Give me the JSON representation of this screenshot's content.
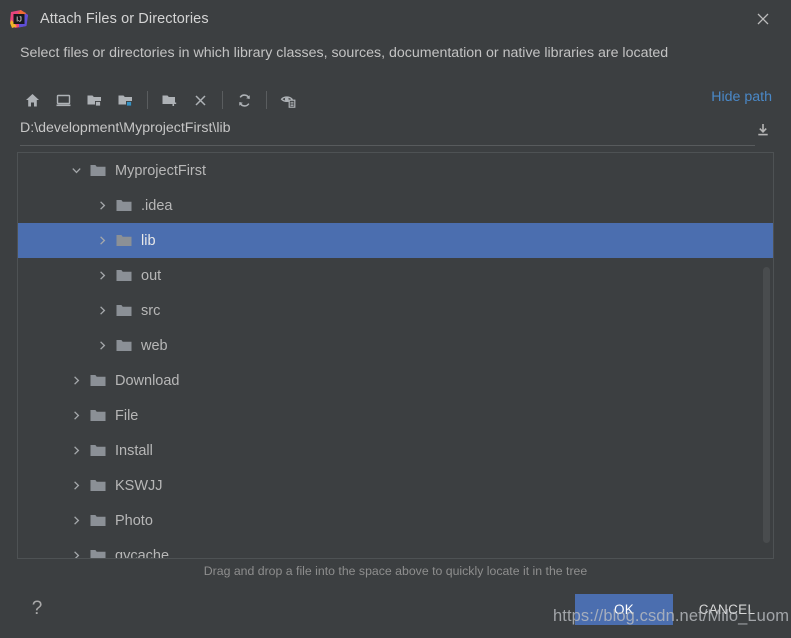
{
  "titlebar": {
    "title": "Attach Files or Directories",
    "logo_icon": "intellij-idea-logo-icon",
    "close_icon": "close-icon"
  },
  "subtitle": "Select files or directories in which library classes, sources, documentation or native libraries are located",
  "toolbar": {
    "hide_path_label": "Hide path",
    "buttons": [
      {
        "name": "home-button",
        "icon": "home-icon"
      },
      {
        "name": "desktop-button",
        "icon": "desktop-icon"
      },
      {
        "name": "module-directory-button",
        "icon": "folder-module-icon"
      },
      {
        "name": "project-directory-button",
        "icon": "folder-project-icon"
      },
      {
        "name": "new-folder-button",
        "icon": "folder-add-icon"
      },
      {
        "name": "delete-button",
        "icon": "x-delete-icon"
      },
      {
        "name": "refresh-button",
        "icon": "refresh-icon"
      },
      {
        "name": "show-hidden-files-button",
        "icon": "hidden-files-icon"
      }
    ]
  },
  "path": {
    "value": "D:\\development\\MyprojectFirst\\lib",
    "download_icon": "download-icon"
  },
  "tree": {
    "nodes": [
      {
        "label": "MyprojectFirst",
        "depth": 1,
        "expanded": true,
        "selected": false
      },
      {
        "label": ".idea",
        "depth": 2,
        "expanded": false,
        "selected": false
      },
      {
        "label": "lib",
        "depth": 2,
        "expanded": false,
        "selected": true
      },
      {
        "label": "out",
        "depth": 2,
        "expanded": false,
        "selected": false
      },
      {
        "label": "src",
        "depth": 2,
        "expanded": false,
        "selected": false
      },
      {
        "label": "web",
        "depth": 2,
        "expanded": false,
        "selected": false
      },
      {
        "label": "Download",
        "depth": 1,
        "expanded": false,
        "selected": false
      },
      {
        "label": "File",
        "depth": 1,
        "expanded": false,
        "selected": false
      },
      {
        "label": "Install",
        "depth": 1,
        "expanded": false,
        "selected": false
      },
      {
        "label": "KSWJJ",
        "depth": 1,
        "expanded": false,
        "selected": false
      },
      {
        "label": "Photo",
        "depth": 1,
        "expanded": false,
        "selected": false
      },
      {
        "label": "qycache",
        "depth": 1,
        "expanded": false,
        "selected": false
      }
    ]
  },
  "drag_hint": "Drag and drop a file into the space above to quickly locate it in the tree",
  "footer": {
    "help_label": "?",
    "ok_label": "OK",
    "cancel_label": "CANCEL"
  },
  "watermark": "https://blog.csdn.net/Milo_Luom",
  "colors": {
    "dialog_background": "#3c3f41",
    "selection_blue": "#4b6eaf",
    "link_blue": "#4a88c7",
    "text_primary": "#bbbbbb",
    "folder_gray": "#8b9096"
  }
}
